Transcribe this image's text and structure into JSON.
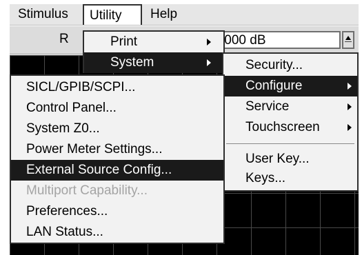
{
  "menubar": {
    "items": [
      {
        "label": "Stimulus"
      },
      {
        "label": "Utility"
      },
      {
        "label": "Help"
      }
    ]
  },
  "toolbar": {
    "label_partial": "R",
    "value_partial": ".000 dB"
  },
  "utility_menu": {
    "items": [
      {
        "label": "Print"
      },
      {
        "label": "System"
      }
    ]
  },
  "system_menu": {
    "items": [
      {
        "label": "Security..."
      },
      {
        "label": "Configure"
      },
      {
        "label": "Service"
      },
      {
        "label": "Touchscreen"
      },
      {
        "label": "User Key..."
      },
      {
        "label": "Keys..."
      }
    ]
  },
  "configure_menu": {
    "items": [
      {
        "label": "SICL/GPIB/SCPI..."
      },
      {
        "label": "Control Panel..."
      },
      {
        "label": "System Z0..."
      },
      {
        "label": "Power Meter Settings..."
      },
      {
        "label": "External Source Config..."
      },
      {
        "label": "Multiport Capability..."
      },
      {
        "label": "Preferences..."
      },
      {
        "label": "LAN Status..."
      }
    ]
  },
  "icons": {
    "submenu": "chevron-right-icon",
    "spin": "spin-up-icon"
  },
  "colors": {
    "menu_background": "#f2f2f2",
    "selected_background": "#1a1a1a",
    "disabled_text": "#a4a4a4",
    "plot_background": "#000000"
  }
}
